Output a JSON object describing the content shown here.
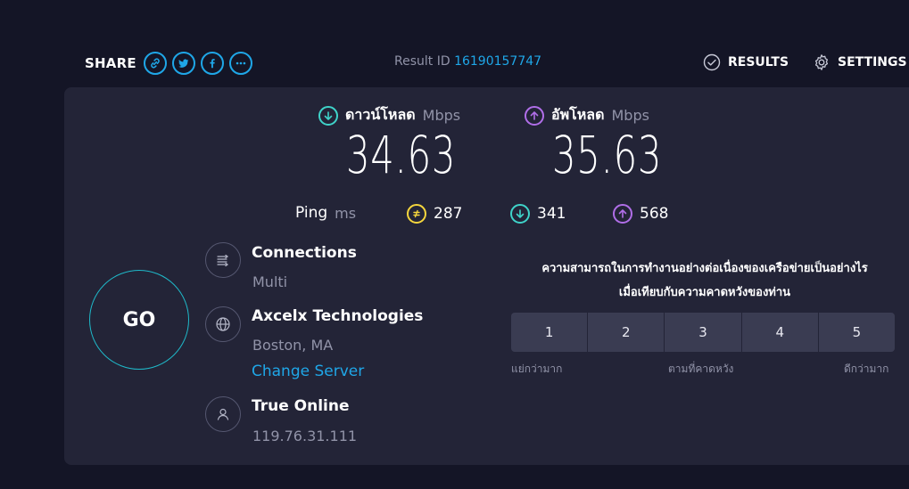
{
  "header": {
    "share_label": "SHARE",
    "share_icons": [
      "link-icon",
      "twitter-icon",
      "facebook-icon",
      "more-icon"
    ],
    "result_id_label": "Result ID",
    "result_id_value": "16190157747",
    "results_label": "RESULTS",
    "settings_label": "SETTINGS"
  },
  "download": {
    "label": "ดาวน์โหลด",
    "unit": "Mbps",
    "value": "34.63",
    "color": "#3fd3c9"
  },
  "upload": {
    "label": "อัพโหลด",
    "unit": "Mbps",
    "value": "35.63",
    "color": "#b06ee8"
  },
  "ping": {
    "label": "Ping",
    "unit": "ms",
    "idle": "287",
    "download": "341",
    "upload": "568",
    "idle_color": "#f5d63d"
  },
  "go_label": "GO",
  "connections": {
    "title": "Connections",
    "value": "Multi"
  },
  "server": {
    "name": "Axcelx Technologies",
    "location": "Boston, MA",
    "change_label": "Change Server"
  },
  "isp": {
    "name": "True Online",
    "ip": "119.76.31.111"
  },
  "survey": {
    "question_line1": "ความสามารถในการทำงานอย่างต่อเนื่องของเครือข่ายเป็นอย่างไร",
    "question_line2": "เมื่อเทียบกับความคาดหวังของท่าน",
    "options": [
      "1",
      "2",
      "3",
      "4",
      "5"
    ],
    "low_label": "แย่กว่ามาก",
    "mid_label": "ตามที่คาดหวัง",
    "high_label": "ดีกว่ามาก"
  },
  "colors": {
    "accent": "#1fa7e8",
    "background": "#141526",
    "panel": "#232437"
  }
}
